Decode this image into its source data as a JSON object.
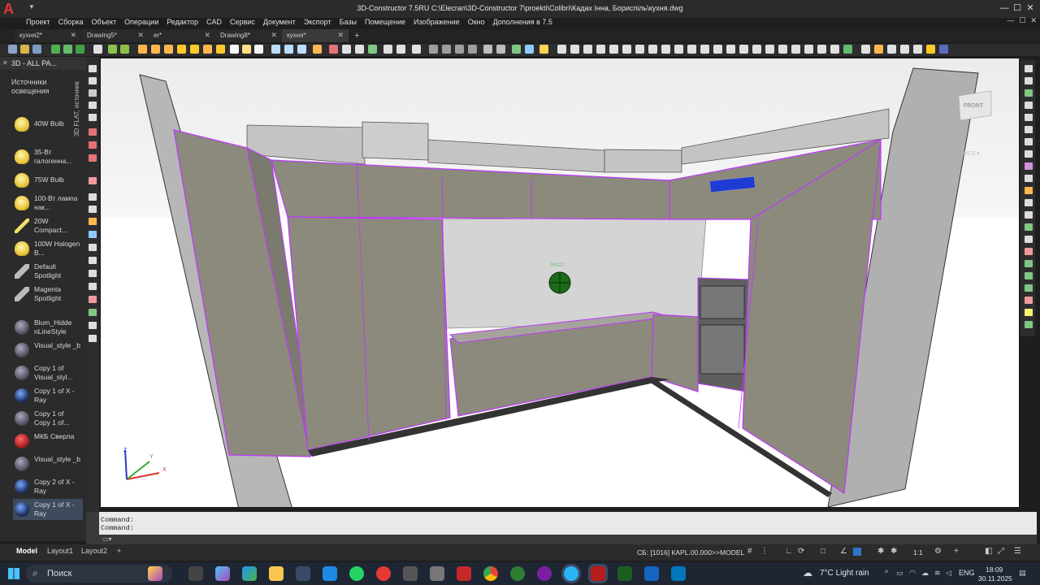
{
  "app": {
    "logo": "A",
    "title": "3D-Constructor 7.5RU   C:\\Elecran\\3D-Constructor 7\\proekti\\Colibri\\Кадах Інна, Бориспіль\\кухня.dwg"
  },
  "window_controls": {
    "minimize": "—",
    "maximize": "☐",
    "close": "✕"
  },
  "menu": [
    "Проект",
    "Сборка",
    "Объект",
    "Операции",
    "Редактор",
    "CAD",
    "Сервис",
    "Документ",
    "Экспорт",
    "Базы",
    "Помещение",
    "Изображение",
    "Окно",
    "Дополнения в 7.5"
  ],
  "file_tabs": [
    {
      "label": "кухня2*",
      "active": false
    },
    {
      "label": "Drawing5*",
      "active": false
    },
    {
      "label": "er*",
      "active": false
    },
    {
      "label": "Drawing8*",
      "active": false
    },
    {
      "label": "кухня*",
      "active": true
    }
  ],
  "tab_close": "✕",
  "tab_add": "+",
  "palette": {
    "title": "3D - ALL PA...",
    "close": "✕",
    "section": "Источники освещения",
    "strip_label": "3D FLAT, источник",
    "items": [
      {
        "label": "40W Bulb",
        "icon": "bulb-icon",
        "active": false
      },
      {
        "label": "35-Вт галогенна...",
        "icon": "bulb-icon",
        "active": false
      },
      {
        "label": "75W Bulb",
        "icon": "bulb-icon",
        "active": false
      },
      {
        "label": "100-Вт лампа нак...",
        "icon": "bulb-icon",
        "active": false
      },
      {
        "label": "20W Compact...",
        "icon": "fluorescent-tube-icon",
        "active": false
      },
      {
        "label": "100W Halogen B...",
        "icon": "bulb-icon",
        "active": false
      },
      {
        "label": "Default Spotlight",
        "icon": "spotlight-icon",
        "active": false
      },
      {
        "label": "Magenta Spotlight",
        "icon": "spotlight-icon",
        "active": false
      },
      {
        "label": "Blum_Hidde nLineStyle",
        "icon": "visual-style-icon",
        "active": false
      },
      {
        "label": "Visual_style _b",
        "icon": "visual-style-icon",
        "active": false
      },
      {
        "label": "Copy 1 of Visual_styl...",
        "icon": "visual-style-icon",
        "active": false
      },
      {
        "label": "Copy 1 of X -Ray",
        "icon": "xray-style-icon",
        "active": false
      },
      {
        "label": "Copy 1 of Copy 1 of...",
        "icon": "visual-style-icon",
        "active": false
      },
      {
        "label": "МКБ Сверла",
        "icon": "drill-style-icon",
        "active": false
      },
      {
        "label": "Visual_style _b",
        "icon": "visual-style-icon",
        "active": false
      },
      {
        "label": "Copy 2 of X -Ray",
        "icon": "xray-style-icon",
        "active": false
      },
      {
        "label": "Copy 1 of X -Ray",
        "icon": "xray-style-icon",
        "active": true
      }
    ]
  },
  "viewport": {
    "viewcube_face": "FRONT",
    "wcs_label": "WCS ▾",
    "pivot_label": "PIVOT",
    "ucs_axes": [
      "X",
      "Y",
      "Z"
    ]
  },
  "command_line": {
    "history": [
      "Command:",
      "Command:"
    ],
    "input_icon": "▭▾"
  },
  "layout_tabs": [
    {
      "label": "Model",
      "active": true
    },
    {
      "label": "Layout1",
      "active": false
    },
    {
      "label": "Layout2",
      "active": false
    }
  ],
  "layout_add": "+",
  "status": {
    "coords": "СБ: [1016] КАРL.00.000>>",
    "space": "MODEL",
    "scale": "1:1"
  },
  "taskbar": {
    "search_placeholder": "Поиск",
    "weather_temp": "7°C",
    "weather_text": "Light rain",
    "language": "ENG",
    "time": "18:09",
    "date": "30.11.2025"
  },
  "colors": {
    "cabinet": "#8b8a7c",
    "wall": "#c6c6c6",
    "selection": "#c036ff",
    "title_bg": "#2b2b2b"
  }
}
